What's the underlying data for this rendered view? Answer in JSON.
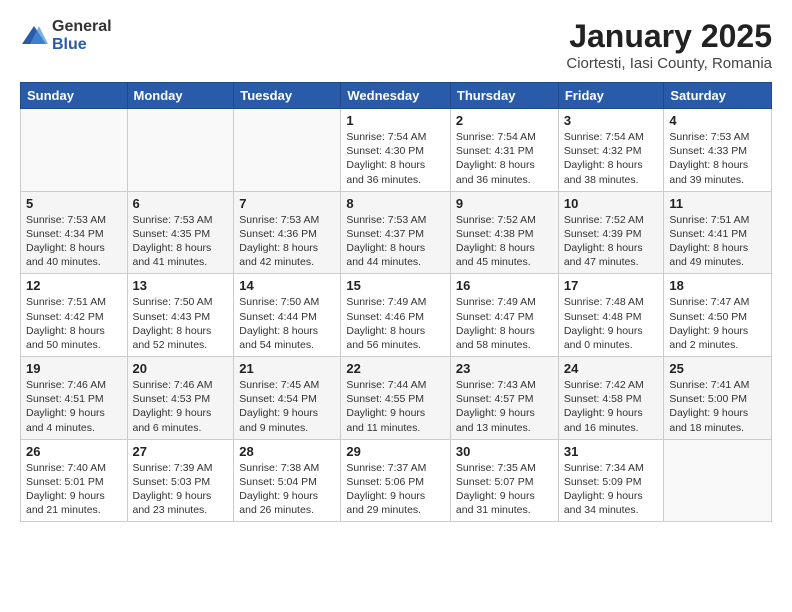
{
  "logo": {
    "general": "General",
    "blue": "Blue"
  },
  "title": "January 2025",
  "subtitle": "Ciortesti, Iasi County, Romania",
  "days_header": [
    "Sunday",
    "Monday",
    "Tuesday",
    "Wednesday",
    "Thursday",
    "Friday",
    "Saturday"
  ],
  "weeks": [
    [
      {
        "day": "",
        "info": ""
      },
      {
        "day": "",
        "info": ""
      },
      {
        "day": "",
        "info": ""
      },
      {
        "day": "1",
        "info": "Sunrise: 7:54 AM\nSunset: 4:30 PM\nDaylight: 8 hours and 36 minutes."
      },
      {
        "day": "2",
        "info": "Sunrise: 7:54 AM\nSunset: 4:31 PM\nDaylight: 8 hours and 36 minutes."
      },
      {
        "day": "3",
        "info": "Sunrise: 7:54 AM\nSunset: 4:32 PM\nDaylight: 8 hours and 38 minutes."
      },
      {
        "day": "4",
        "info": "Sunrise: 7:53 AM\nSunset: 4:33 PM\nDaylight: 8 hours and 39 minutes."
      }
    ],
    [
      {
        "day": "5",
        "info": "Sunrise: 7:53 AM\nSunset: 4:34 PM\nDaylight: 8 hours and 40 minutes."
      },
      {
        "day": "6",
        "info": "Sunrise: 7:53 AM\nSunset: 4:35 PM\nDaylight: 8 hours and 41 minutes."
      },
      {
        "day": "7",
        "info": "Sunrise: 7:53 AM\nSunset: 4:36 PM\nDaylight: 8 hours and 42 minutes."
      },
      {
        "day": "8",
        "info": "Sunrise: 7:53 AM\nSunset: 4:37 PM\nDaylight: 8 hours and 44 minutes."
      },
      {
        "day": "9",
        "info": "Sunrise: 7:52 AM\nSunset: 4:38 PM\nDaylight: 8 hours and 45 minutes."
      },
      {
        "day": "10",
        "info": "Sunrise: 7:52 AM\nSunset: 4:39 PM\nDaylight: 8 hours and 47 minutes."
      },
      {
        "day": "11",
        "info": "Sunrise: 7:51 AM\nSunset: 4:41 PM\nDaylight: 8 hours and 49 minutes."
      }
    ],
    [
      {
        "day": "12",
        "info": "Sunrise: 7:51 AM\nSunset: 4:42 PM\nDaylight: 8 hours and 50 minutes."
      },
      {
        "day": "13",
        "info": "Sunrise: 7:50 AM\nSunset: 4:43 PM\nDaylight: 8 hours and 52 minutes."
      },
      {
        "day": "14",
        "info": "Sunrise: 7:50 AM\nSunset: 4:44 PM\nDaylight: 8 hours and 54 minutes."
      },
      {
        "day": "15",
        "info": "Sunrise: 7:49 AM\nSunset: 4:46 PM\nDaylight: 8 hours and 56 minutes."
      },
      {
        "day": "16",
        "info": "Sunrise: 7:49 AM\nSunset: 4:47 PM\nDaylight: 8 hours and 58 minutes."
      },
      {
        "day": "17",
        "info": "Sunrise: 7:48 AM\nSunset: 4:48 PM\nDaylight: 9 hours and 0 minutes."
      },
      {
        "day": "18",
        "info": "Sunrise: 7:47 AM\nSunset: 4:50 PM\nDaylight: 9 hours and 2 minutes."
      }
    ],
    [
      {
        "day": "19",
        "info": "Sunrise: 7:46 AM\nSunset: 4:51 PM\nDaylight: 9 hours and 4 minutes."
      },
      {
        "day": "20",
        "info": "Sunrise: 7:46 AM\nSunset: 4:53 PM\nDaylight: 9 hours and 6 minutes."
      },
      {
        "day": "21",
        "info": "Sunrise: 7:45 AM\nSunset: 4:54 PM\nDaylight: 9 hours and 9 minutes."
      },
      {
        "day": "22",
        "info": "Sunrise: 7:44 AM\nSunset: 4:55 PM\nDaylight: 9 hours and 11 minutes."
      },
      {
        "day": "23",
        "info": "Sunrise: 7:43 AM\nSunset: 4:57 PM\nDaylight: 9 hours and 13 minutes."
      },
      {
        "day": "24",
        "info": "Sunrise: 7:42 AM\nSunset: 4:58 PM\nDaylight: 9 hours and 16 minutes."
      },
      {
        "day": "25",
        "info": "Sunrise: 7:41 AM\nSunset: 5:00 PM\nDaylight: 9 hours and 18 minutes."
      }
    ],
    [
      {
        "day": "26",
        "info": "Sunrise: 7:40 AM\nSunset: 5:01 PM\nDaylight: 9 hours and 21 minutes."
      },
      {
        "day": "27",
        "info": "Sunrise: 7:39 AM\nSunset: 5:03 PM\nDaylight: 9 hours and 23 minutes."
      },
      {
        "day": "28",
        "info": "Sunrise: 7:38 AM\nSunset: 5:04 PM\nDaylight: 9 hours and 26 minutes."
      },
      {
        "day": "29",
        "info": "Sunrise: 7:37 AM\nSunset: 5:06 PM\nDaylight: 9 hours and 29 minutes."
      },
      {
        "day": "30",
        "info": "Sunrise: 7:35 AM\nSunset: 5:07 PM\nDaylight: 9 hours and 31 minutes."
      },
      {
        "day": "31",
        "info": "Sunrise: 7:34 AM\nSunset: 5:09 PM\nDaylight: 9 hours and 34 minutes."
      },
      {
        "day": "",
        "info": ""
      }
    ]
  ]
}
